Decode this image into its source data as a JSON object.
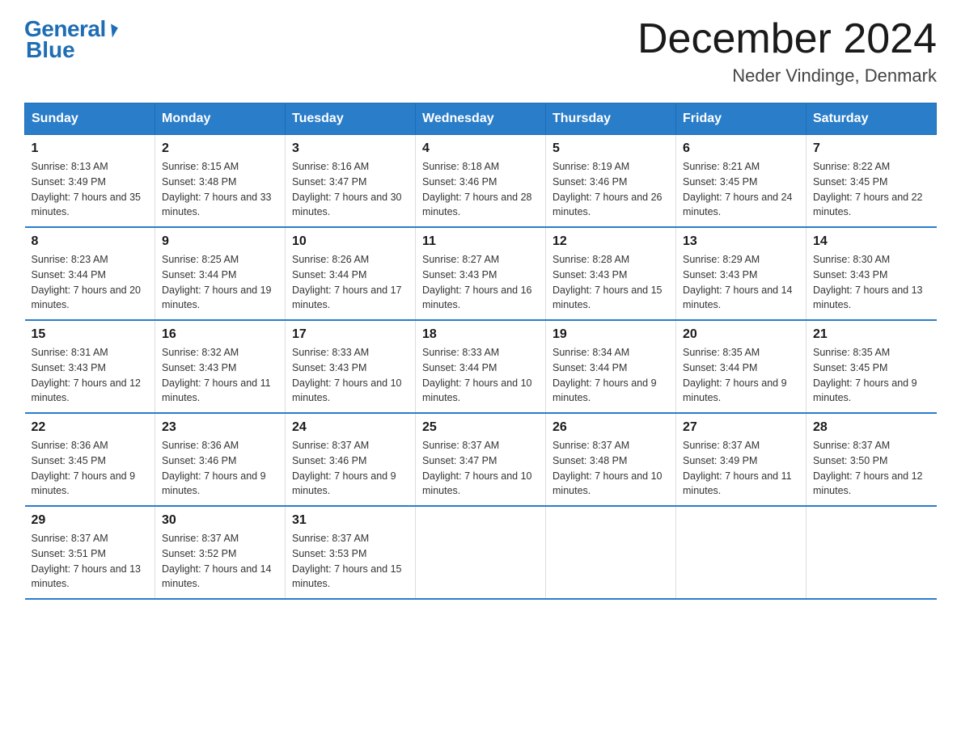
{
  "logo": {
    "general": "General",
    "blue": "Blue"
  },
  "title": "December 2024",
  "location": "Neder Vindinge, Denmark",
  "days_header": [
    "Sunday",
    "Monday",
    "Tuesday",
    "Wednesday",
    "Thursday",
    "Friday",
    "Saturday"
  ],
  "weeks": [
    [
      {
        "day": "1",
        "sunrise": "8:13 AM",
        "sunset": "3:49 PM",
        "daylight": "7 hours and 35 minutes."
      },
      {
        "day": "2",
        "sunrise": "8:15 AM",
        "sunset": "3:48 PM",
        "daylight": "7 hours and 33 minutes."
      },
      {
        "day": "3",
        "sunrise": "8:16 AM",
        "sunset": "3:47 PM",
        "daylight": "7 hours and 30 minutes."
      },
      {
        "day": "4",
        "sunrise": "8:18 AM",
        "sunset": "3:46 PM",
        "daylight": "7 hours and 28 minutes."
      },
      {
        "day": "5",
        "sunrise": "8:19 AM",
        "sunset": "3:46 PM",
        "daylight": "7 hours and 26 minutes."
      },
      {
        "day": "6",
        "sunrise": "8:21 AM",
        "sunset": "3:45 PM",
        "daylight": "7 hours and 24 minutes."
      },
      {
        "day": "7",
        "sunrise": "8:22 AM",
        "sunset": "3:45 PM",
        "daylight": "7 hours and 22 minutes."
      }
    ],
    [
      {
        "day": "8",
        "sunrise": "8:23 AM",
        "sunset": "3:44 PM",
        "daylight": "7 hours and 20 minutes."
      },
      {
        "day": "9",
        "sunrise": "8:25 AM",
        "sunset": "3:44 PM",
        "daylight": "7 hours and 19 minutes."
      },
      {
        "day": "10",
        "sunrise": "8:26 AM",
        "sunset": "3:44 PM",
        "daylight": "7 hours and 17 minutes."
      },
      {
        "day": "11",
        "sunrise": "8:27 AM",
        "sunset": "3:43 PM",
        "daylight": "7 hours and 16 minutes."
      },
      {
        "day": "12",
        "sunrise": "8:28 AM",
        "sunset": "3:43 PM",
        "daylight": "7 hours and 15 minutes."
      },
      {
        "day": "13",
        "sunrise": "8:29 AM",
        "sunset": "3:43 PM",
        "daylight": "7 hours and 14 minutes."
      },
      {
        "day": "14",
        "sunrise": "8:30 AM",
        "sunset": "3:43 PM",
        "daylight": "7 hours and 13 minutes."
      }
    ],
    [
      {
        "day": "15",
        "sunrise": "8:31 AM",
        "sunset": "3:43 PM",
        "daylight": "7 hours and 12 minutes."
      },
      {
        "day": "16",
        "sunrise": "8:32 AM",
        "sunset": "3:43 PM",
        "daylight": "7 hours and 11 minutes."
      },
      {
        "day": "17",
        "sunrise": "8:33 AM",
        "sunset": "3:43 PM",
        "daylight": "7 hours and 10 minutes."
      },
      {
        "day": "18",
        "sunrise": "8:33 AM",
        "sunset": "3:44 PM",
        "daylight": "7 hours and 10 minutes."
      },
      {
        "day": "19",
        "sunrise": "8:34 AM",
        "sunset": "3:44 PM",
        "daylight": "7 hours and 9 minutes."
      },
      {
        "day": "20",
        "sunrise": "8:35 AM",
        "sunset": "3:44 PM",
        "daylight": "7 hours and 9 minutes."
      },
      {
        "day": "21",
        "sunrise": "8:35 AM",
        "sunset": "3:45 PM",
        "daylight": "7 hours and 9 minutes."
      }
    ],
    [
      {
        "day": "22",
        "sunrise": "8:36 AM",
        "sunset": "3:45 PM",
        "daylight": "7 hours and 9 minutes."
      },
      {
        "day": "23",
        "sunrise": "8:36 AM",
        "sunset": "3:46 PM",
        "daylight": "7 hours and 9 minutes."
      },
      {
        "day": "24",
        "sunrise": "8:37 AM",
        "sunset": "3:46 PM",
        "daylight": "7 hours and 9 minutes."
      },
      {
        "day": "25",
        "sunrise": "8:37 AM",
        "sunset": "3:47 PM",
        "daylight": "7 hours and 10 minutes."
      },
      {
        "day": "26",
        "sunrise": "8:37 AM",
        "sunset": "3:48 PM",
        "daylight": "7 hours and 10 minutes."
      },
      {
        "day": "27",
        "sunrise": "8:37 AM",
        "sunset": "3:49 PM",
        "daylight": "7 hours and 11 minutes."
      },
      {
        "day": "28",
        "sunrise": "8:37 AM",
        "sunset": "3:50 PM",
        "daylight": "7 hours and 12 minutes."
      }
    ],
    [
      {
        "day": "29",
        "sunrise": "8:37 AM",
        "sunset": "3:51 PM",
        "daylight": "7 hours and 13 minutes."
      },
      {
        "day": "30",
        "sunrise": "8:37 AM",
        "sunset": "3:52 PM",
        "daylight": "7 hours and 14 minutes."
      },
      {
        "day": "31",
        "sunrise": "8:37 AM",
        "sunset": "3:53 PM",
        "daylight": "7 hours and 15 minutes."
      },
      null,
      null,
      null,
      null
    ]
  ]
}
